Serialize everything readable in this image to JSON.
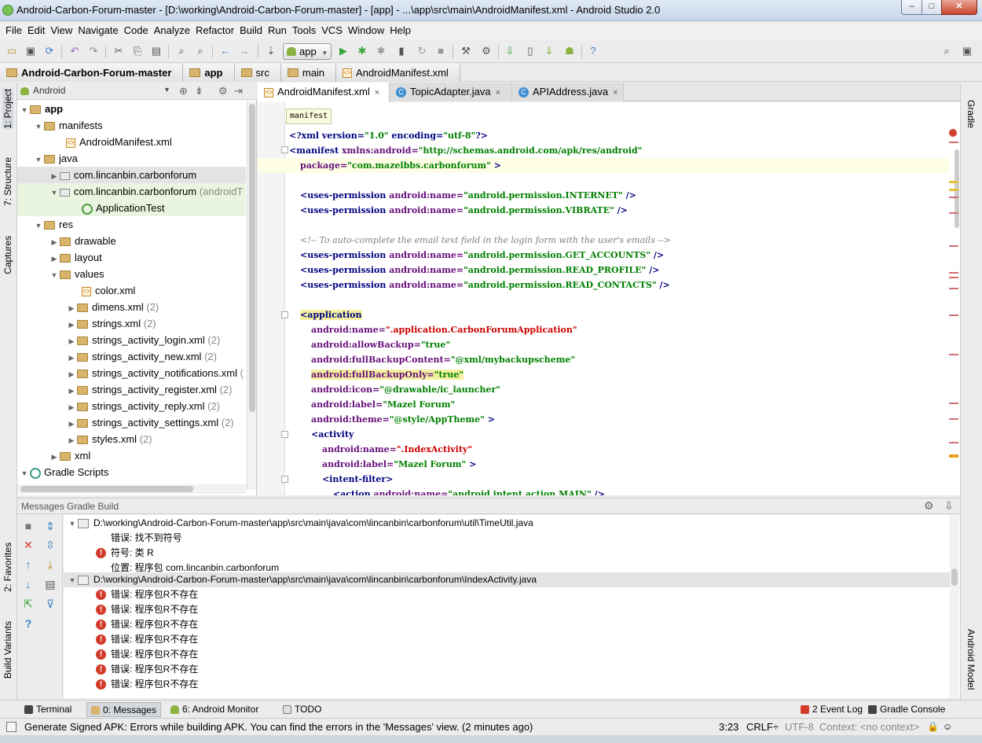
{
  "window": {
    "title": "Android-Carbon-Forum-master - [D:\\working\\Android-Carbon-Forum-master] - [app] - ...\\app\\src\\main\\AndroidManifest.xml - Android Studio 2.0",
    "min": "‒",
    "max": "□",
    "close": "✕"
  },
  "menu": [
    "File",
    "Edit",
    "View",
    "Navigate",
    "Code",
    "Analyze",
    "Refactor",
    "Build",
    "Run",
    "Tools",
    "VCS",
    "Window",
    "Help"
  ],
  "toolbar": {
    "run_config": "app"
  },
  "breadcrumb": [
    "Android-Carbon-Forum-master",
    "app",
    "src",
    "main",
    "AndroidManifest.xml"
  ],
  "left_strip": [
    "1: Project",
    "7: Structure",
    "Captures",
    "2: Favorites",
    "Build Variants"
  ],
  "right_strip": [
    "Gradle",
    "Android Model"
  ],
  "project": {
    "view_selector": "Android",
    "tree": [
      {
        "label": "app",
        "extra": ""
      },
      {
        "label": "manifests",
        "extra": ""
      },
      {
        "label": "AndroidManifest.xml",
        "extra": ""
      },
      {
        "label": "java",
        "extra": ""
      },
      {
        "label": "com.lincanbin.carbonforum",
        "extra": ""
      },
      {
        "label": "com.lincanbin.carbonforum",
        "extra": "(androidT"
      },
      {
        "label": "ApplicationTest",
        "extra": ""
      },
      {
        "label": "res",
        "extra": ""
      },
      {
        "label": "drawable",
        "extra": ""
      },
      {
        "label": "layout",
        "extra": ""
      },
      {
        "label": "values",
        "extra": ""
      },
      {
        "label": "color.xml",
        "extra": ""
      },
      {
        "label": "dimens.xml",
        "extra": "(2)"
      },
      {
        "label": "strings.xml",
        "extra": "(2)"
      },
      {
        "label": "strings_activity_login.xml",
        "extra": "(2)"
      },
      {
        "label": "strings_activity_new.xml",
        "extra": "(2)"
      },
      {
        "label": "strings_activity_notifications.xml",
        "extra": "("
      },
      {
        "label": "strings_activity_register.xml",
        "extra": "(2)"
      },
      {
        "label": "strings_activity_reply.xml",
        "extra": "(2)"
      },
      {
        "label": "strings_activity_settings.xml",
        "extra": "(2)"
      },
      {
        "label": "styles.xml",
        "extra": "(2)"
      },
      {
        "label": "xml",
        "extra": ""
      },
      {
        "label": "Gradle Scripts",
        "extra": ""
      }
    ]
  },
  "editor": {
    "tabs": [
      "AndroidManifest.xml",
      "TopicAdapter.java",
      "APIAddress.java"
    ],
    "tab_close": "×",
    "code_breadcrumb": "manifest",
    "lines": {
      "l1a": "<?xml version=",
      "l1b": "\"1.0\"",
      "l1c": " encoding=",
      "l1d": "\"utf-8\"",
      "l1e": "?>",
      "l2a": "<manifest ",
      "l2b": "xmlns:android=",
      "l2c": "\"http://schemas.android.com/apk/res/android\"",
      "l3a": "package=",
      "l3b": "\"com.mazelbbs.carbonforum\"",
      "l3c": " >",
      "perm_tag": "<uses-permission ",
      "perm_attr": "android:name=",
      "perm_end": " />",
      "p1": "\"android.permission.INTERNET\"",
      "p2": "\"android.permission.VIBRATE\"",
      "comment": "<!-- To auto-complete the email text field in the login form with the user's emails -->",
      "p3": "\"android.permission.GET_ACCOUNTS\"",
      "p4": "\"android.permission.READ_PROFILE\"",
      "p5": "\"android.permission.READ_CONTACTS\"",
      "app_tag": "<application",
      "a1": "android:name=",
      "v1": "\".application.CarbonForumApplication\"",
      "a2": "android:allowBackup=",
      "v2": "\"true\"",
      "a3": "android:fullBackupContent=",
      "v3": "\"@xml/mybackupscheme\"",
      "a4": "android:fullBackupOnly=",
      "v4": "\"true\"",
      "a5": "android:icon=",
      "v5": "\"@drawable/ic_launcher\"",
      "a6": "android:label=",
      "v6": "\"Mazel Forum\"",
      "a7": "android:theme=",
      "v7": "\"@style/AppTheme\"",
      "e7": " >",
      "act_tag": "<activity",
      "b1": "android:name=",
      "w1": "\".IndexActivity\"",
      "b2": "android:label=",
      "w2": "\"Mazel Forum\"",
      "e2": " >",
      "intent_tag": "<intent-filter>",
      "action_tag": "<action ",
      "action_attr": "android:name=",
      "action_val": "\"android.intent.action.MAIN\"",
      "action_end": " />"
    }
  },
  "messages": {
    "header": "Messages Gradle Build",
    "rows": [
      {
        "text": "D:\\working\\Android-Carbon-Forum-master\\app\\src\\main\\java\\com\\lincanbin\\carbonforum\\util\\TimeUtil.java"
      },
      {
        "text": "错误: 找不到符号"
      },
      {
        "text": "符号:   类 R"
      },
      {
        "text": "位置: 程序包 com.lincanbin.carbonforum"
      },
      {
        "text": "D:\\working\\Android-Carbon-Forum-master\\app\\src\\main\\java\\com\\lincanbin\\carbonforum\\IndexActivity.java"
      },
      {
        "text": "错误: 程序包R不存在"
      },
      {
        "text": "错误: 程序包R不存在"
      },
      {
        "text": "错误: 程序包R不存在"
      },
      {
        "text": "错误: 程序包R不存在"
      },
      {
        "text": "错误: 程序包R不存在"
      },
      {
        "text": "错误: 程序包R不存在"
      },
      {
        "text": "错误: 程序包R不存在"
      }
    ]
  },
  "bottom_tabs": {
    "terminal": "Terminal",
    "messages": "0: Messages",
    "monitor": "6: Android Monitor",
    "todo": "TODO",
    "event_log": "2 Event Log",
    "gradle_console": "Gradle Console"
  },
  "status": {
    "message": "Generate Signed APK: Errors while building APK. You can find the errors in the 'Messages' view. (2 minutes ago)",
    "position": "3:23",
    "line_sep": "CRLF÷",
    "encoding": "UTF-8",
    "context": "Context: <no context>"
  },
  "colors": {
    "accent_green": "#8ab33f",
    "error_red": "#d23a2a",
    "xml_tag": "#000080",
    "xml_attr": "#660e7a",
    "xml_value": "#008000"
  }
}
